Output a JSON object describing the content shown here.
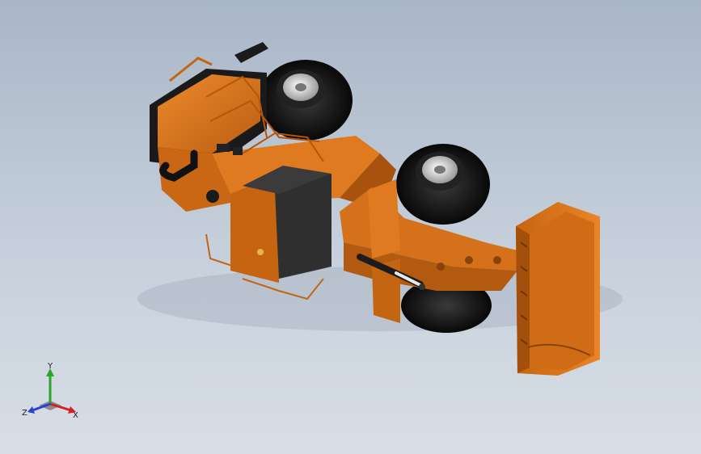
{
  "viewport": {
    "background_top": "#a9b6c6",
    "background_bottom": "#d8dee6"
  },
  "model": {
    "body_color": "#d9731a",
    "body_shade": "#a8520e",
    "body_light": "#ee8a2c",
    "tire_color": "#151515",
    "rim_color": "#d9d9d9"
  },
  "triad": {
    "y_label": "Y",
    "x_label": "X",
    "z_label": "Z",
    "y_color": "#2aa52a",
    "x_color": "#d42020",
    "z_color": "#2b3fd0"
  }
}
